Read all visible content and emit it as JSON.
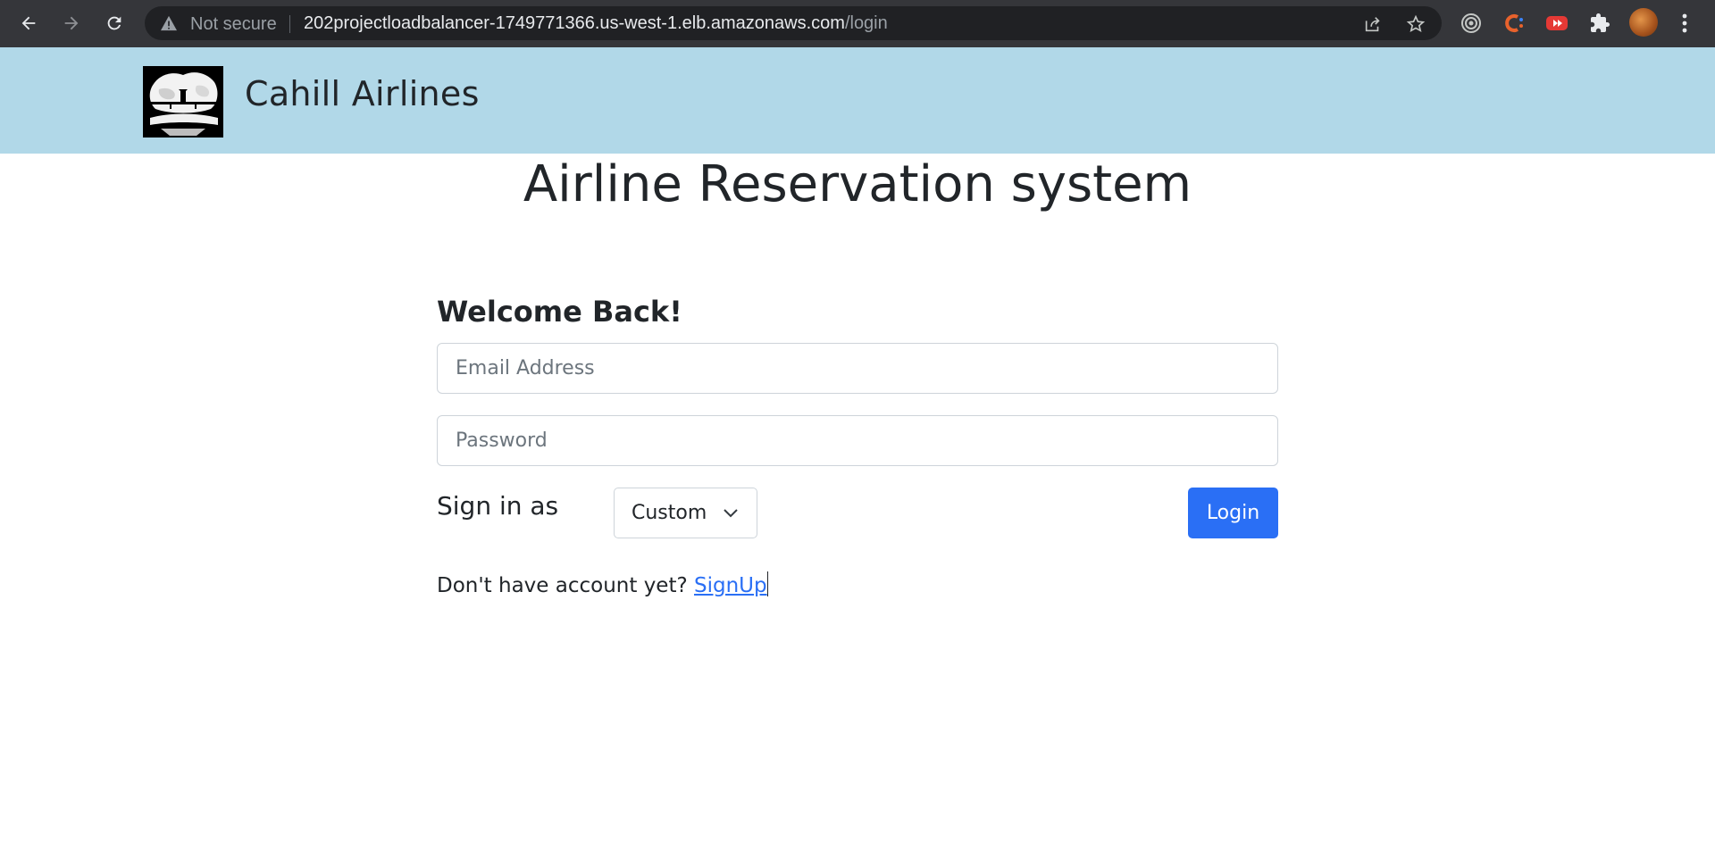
{
  "browser": {
    "security_label": "Not secure",
    "url_host": "202projectloadbalancer-1749771366.us-west-1.elb.amazonaws.com",
    "url_path": "/login",
    "icons": [
      "back-icon",
      "forward-icon",
      "reload-icon",
      "warning-icon",
      "share-icon",
      "star-icon",
      "extension-target-icon",
      "extension-c-icon",
      "extension-youtube-icon",
      "extensions-puzzle-icon",
      "profile-avatar",
      "menu-kebab-icon"
    ]
  },
  "header": {
    "brand": "Cahill Airlines",
    "logo": "airplane-logo"
  },
  "main": {
    "title": "Airline Reservation system",
    "welcome": "Welcome Back!",
    "email_placeholder": "Email Address",
    "email_value": "",
    "password_placeholder": "Password",
    "password_value": "",
    "sign_in_as_label": "Sign in as",
    "role_selected": "Custom",
    "login_label": "Login",
    "signup_prompt": "Don't have account yet?",
    "signup_link": "SignUp"
  },
  "colors": {
    "header_bg": "#b1d8e8",
    "primary": "#2a6ff5",
    "chrome_bg": "#35363a"
  }
}
